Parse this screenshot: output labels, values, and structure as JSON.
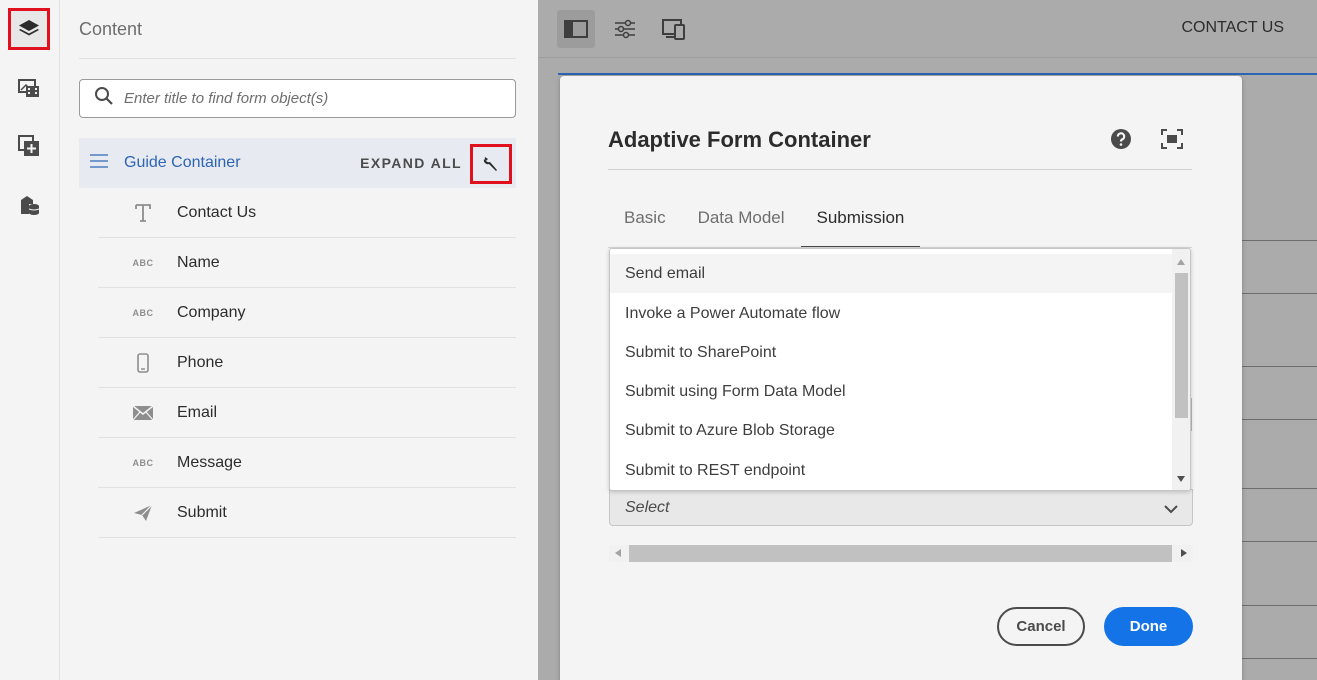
{
  "panel": {
    "title": "Content",
    "search_placeholder": "Enter title to find form object(s)",
    "guide_container": "Guide Container",
    "expand_all": "EXPAND ALL",
    "items": [
      {
        "label": "Contact Us",
        "icon": "text-icon"
      },
      {
        "label": "Name",
        "icon": "abc-icon"
      },
      {
        "label": "Company",
        "icon": "abc-icon"
      },
      {
        "label": "Phone",
        "icon": "phone-icon"
      },
      {
        "label": "Email",
        "icon": "envelope-icon"
      },
      {
        "label": "Message",
        "icon": "abc-icon"
      },
      {
        "label": "Submit",
        "icon": "paper-plane-icon"
      }
    ],
    "abc_glyph": "ABC"
  },
  "topbar": {
    "contact_us": "CONTACT US"
  },
  "dialog": {
    "title": "Adaptive Form Container",
    "tabs": [
      {
        "label": "Basic",
        "active": false
      },
      {
        "label": "Data Model",
        "active": false
      },
      {
        "label": "Submission",
        "active": true
      }
    ],
    "options": [
      "Send email",
      "Invoke a Power Automate flow",
      "Submit to SharePoint",
      "Submit using Form Data Model",
      "Submit to Azure Blob Storage",
      "Submit to REST endpoint"
    ],
    "select_value": "Select",
    "cancel": "Cancel",
    "done": "Done"
  },
  "colors": {
    "accent": "#1473e6",
    "highlight": "#e0101e",
    "link": "#2d64b3"
  }
}
